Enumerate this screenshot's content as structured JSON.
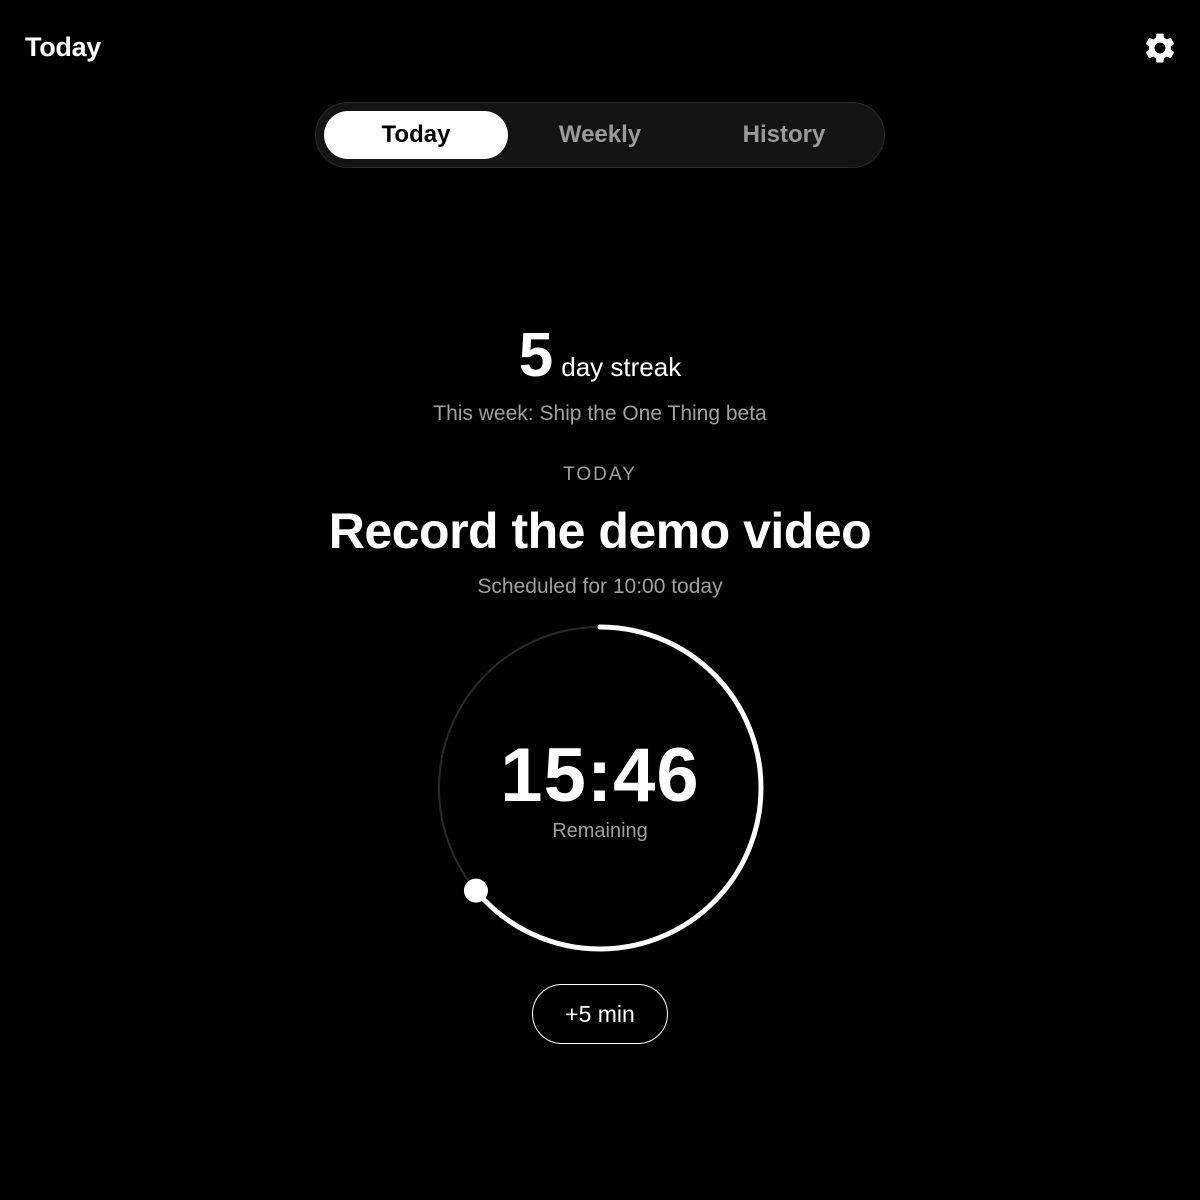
{
  "header": {
    "title": "Today",
    "settings_icon": "gear-icon"
  },
  "tabs": [
    {
      "label": "Today",
      "active": true
    },
    {
      "label": "Weekly",
      "active": false
    },
    {
      "label": "History",
      "active": false
    }
  ],
  "streak": {
    "count": "5",
    "label": "day streak"
  },
  "week_goal": "This week: Ship the One Thing beta",
  "today": {
    "section_label": "TODAY",
    "task_title": "Record the demo video",
    "schedule": "Scheduled for 10:00 today"
  },
  "timer": {
    "time": "15:46",
    "label": "Remaining",
    "remaining_fraction": 0.64
  },
  "add_time_button": "+5 min",
  "colors": {
    "background": "#000000",
    "text": "#ffffff",
    "muted": "#a0a0a0",
    "ring_track": "#2a2a2a",
    "ring_progress": "#ffffff"
  }
}
